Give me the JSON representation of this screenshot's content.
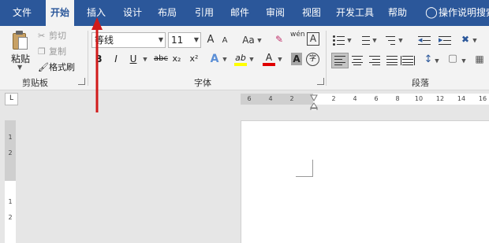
{
  "tabs": [
    {
      "label": "文件"
    },
    {
      "label": "开始"
    },
    {
      "label": "插入"
    },
    {
      "label": "设计"
    },
    {
      "label": "布局"
    },
    {
      "label": "引用"
    },
    {
      "label": "邮件"
    },
    {
      "label": "审阅"
    },
    {
      "label": "视图"
    },
    {
      "label": "开发工具"
    },
    {
      "label": "帮助"
    }
  ],
  "active_tab": "开始",
  "tell_me": {
    "label": "操作说明搜索"
  },
  "clipboard": {
    "paste_label": "粘贴",
    "cut_label": "剪切",
    "copy_label": "复制",
    "format_painter_label": "格式刷",
    "group_label": "剪贴板"
  },
  "font": {
    "font_name": "等线",
    "font_size": "11",
    "group_label": "字体",
    "bold": "B",
    "italic": "I",
    "underline": "U",
    "strikethrough": "abc",
    "subscript": "x₂",
    "superscript": "x²",
    "grow": "A",
    "shrink": "A",
    "change_case": "Aa",
    "phonetic": "wén",
    "char_border": "A",
    "text_effect": "A",
    "highlight": "ab",
    "font_color": "A",
    "char_shading": "A",
    "enclose": "字"
  },
  "paragraph": {
    "group_label": "段落"
  },
  "ruler": {
    "numbers": [
      "6",
      "4",
      "2",
      "2",
      "4",
      "6",
      "8",
      "10",
      "12",
      "14",
      "16"
    ],
    "vertical_numbers": [
      "1",
      "2",
      "1",
      "2"
    ],
    "tab_selector": "L"
  },
  "colors": {
    "tab_bar": "#2b579a",
    "ribbon": "#f3f3f3",
    "highlight_yellow": "#ffff00",
    "font_color_red": "#e00000",
    "annotation_red": "#d11a1a"
  }
}
